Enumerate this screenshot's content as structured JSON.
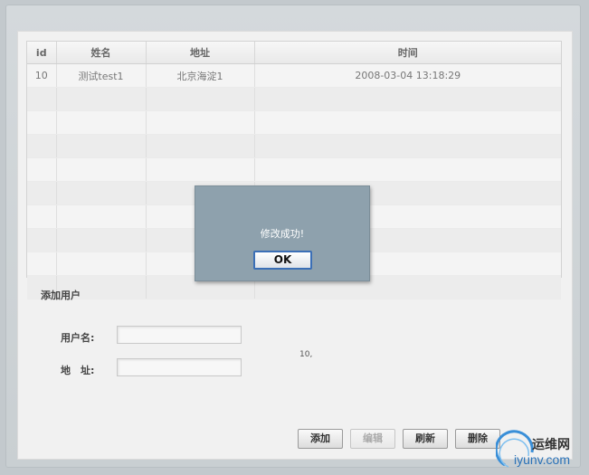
{
  "table": {
    "columns": [
      "id",
      "姓名",
      "地址",
      "时间"
    ],
    "rows": [
      [
        "10",
        "测试test1",
        "北京海淀1",
        "2008-03-04 13:18:29"
      ]
    ]
  },
  "form": {
    "title": "添加用户",
    "username_label": "用户名:",
    "address_label": "地　址:",
    "username_value": "",
    "address_value": "",
    "status_text": "10,"
  },
  "buttons": {
    "add": "添加",
    "edit": "编辑",
    "refresh": "刷新",
    "delete": "删除"
  },
  "dialog": {
    "message": "修改成功!",
    "ok": "OK"
  },
  "watermark": {
    "line1": "运维网",
    "line2": "iyunv.com"
  }
}
